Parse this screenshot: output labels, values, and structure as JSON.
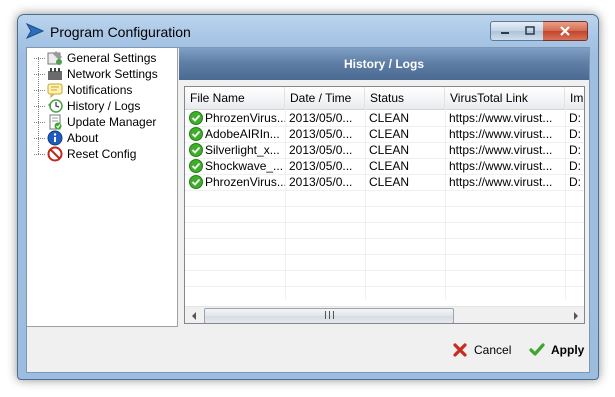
{
  "window": {
    "title": "Program Configuration"
  },
  "tree": {
    "items": [
      {
        "label": "General Settings",
        "icon": "settings-icon"
      },
      {
        "label": "Network Settings",
        "icon": "network-icon"
      },
      {
        "label": "Notifications",
        "icon": "notification-icon"
      },
      {
        "label": "History / Logs",
        "icon": "history-icon"
      },
      {
        "label": "Update Manager",
        "icon": "update-icon"
      },
      {
        "label": "About",
        "icon": "info-icon"
      },
      {
        "label": "Reset Config",
        "icon": "reset-icon"
      }
    ],
    "selected": "History / Logs"
  },
  "panel": {
    "title": "History / Logs"
  },
  "table": {
    "columns": [
      "File Name",
      "Date / Time",
      "Status",
      "VirusTotal Link",
      "Im"
    ],
    "rows": [
      {
        "file": "PhrozenVirus...",
        "date": "2013/05/0...",
        "status": "CLEAN",
        "link": "https://www.virust...",
        "extra": "D:"
      },
      {
        "file": "AdobeAIRIn...",
        "date": "2013/05/0...",
        "status": "CLEAN",
        "link": "https://www.virust...",
        "extra": "D:"
      },
      {
        "file": "Silverlight_x...",
        "date": "2013/05/0...",
        "status": "CLEAN",
        "link": "https://www.virust...",
        "extra": "D:"
      },
      {
        "file": "Shockwave_...",
        "date": "2013/05/0...",
        "status": "CLEAN",
        "link": "https://www.virust...",
        "extra": "D:"
      },
      {
        "file": "PhrozenVirus...",
        "date": "2013/05/0...",
        "status": "CLEAN",
        "link": "https://www.virust...",
        "extra": "D:"
      }
    ]
  },
  "buttons": {
    "cancel_label": "Cancel",
    "apply_label": "Apply"
  },
  "colors": {
    "status_ok": "#3fae2a",
    "cancel_red": "#cc2a1f",
    "apply_green": "#3aa829",
    "header_blue": "#5f7fa6"
  }
}
